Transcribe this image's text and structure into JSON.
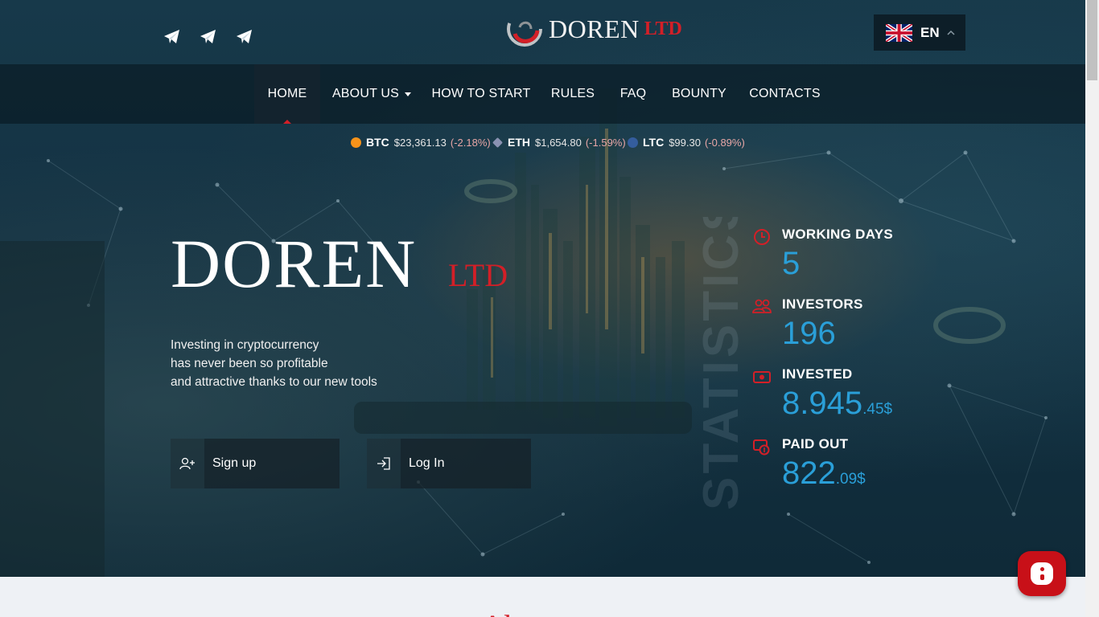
{
  "brand": {
    "logo_name": "DOREN",
    "logo_suffix": "LTD",
    "hero_name": "DOREN",
    "hero_suffix": "LTD",
    "tagline": [
      "Investing in cryptocurrency",
      "has never been so profitable",
      "and attractive thanks to our new tools"
    ]
  },
  "social": {
    "icons": [
      "telegram-icon",
      "telegram-icon",
      "telegram-icon"
    ]
  },
  "language": {
    "selected": "EN",
    "flag": "uk-flag-icon"
  },
  "nav": {
    "items": [
      {
        "label": "HOME",
        "active": true
      },
      {
        "label": "ABOUT US",
        "dropdown": true
      },
      {
        "label": "HOW TO START"
      },
      {
        "label": "RULES"
      },
      {
        "label": "FAQ"
      },
      {
        "label": "BOUNTY"
      },
      {
        "label": "CONTACTS"
      }
    ]
  },
  "ticker": [
    {
      "symbol": "BTC",
      "price": "$23,361.13",
      "change": "(-2.18%)",
      "color": "#f7931a"
    },
    {
      "symbol": "ETH",
      "price": "$1,654.80",
      "change": "(-1.59%)",
      "color": "#8a92b2"
    },
    {
      "symbol": "LTC",
      "price": "$99.30",
      "change": "(-0.89%)",
      "color": "#345d9d"
    }
  ],
  "buttons": {
    "signup": "Sign up",
    "login": "Log In"
  },
  "stats": {
    "watermark": "STATISTICS",
    "working_days": {
      "title": "WORKING DAYS",
      "value": "5"
    },
    "investors": {
      "title": "INVESTORS",
      "value": "196"
    },
    "invested": {
      "title": "INVESTED",
      "value": "8.945",
      "cents": ".45$"
    },
    "paid_out": {
      "title": "PAID OUT",
      "value": "822",
      "cents": ".09$"
    }
  },
  "section": {
    "about_heading_partial": "Ab"
  },
  "colors": {
    "accent_red": "#d31f27",
    "stat_blue": "#2a9fd8",
    "nav_bg": "#0a1c26"
  }
}
